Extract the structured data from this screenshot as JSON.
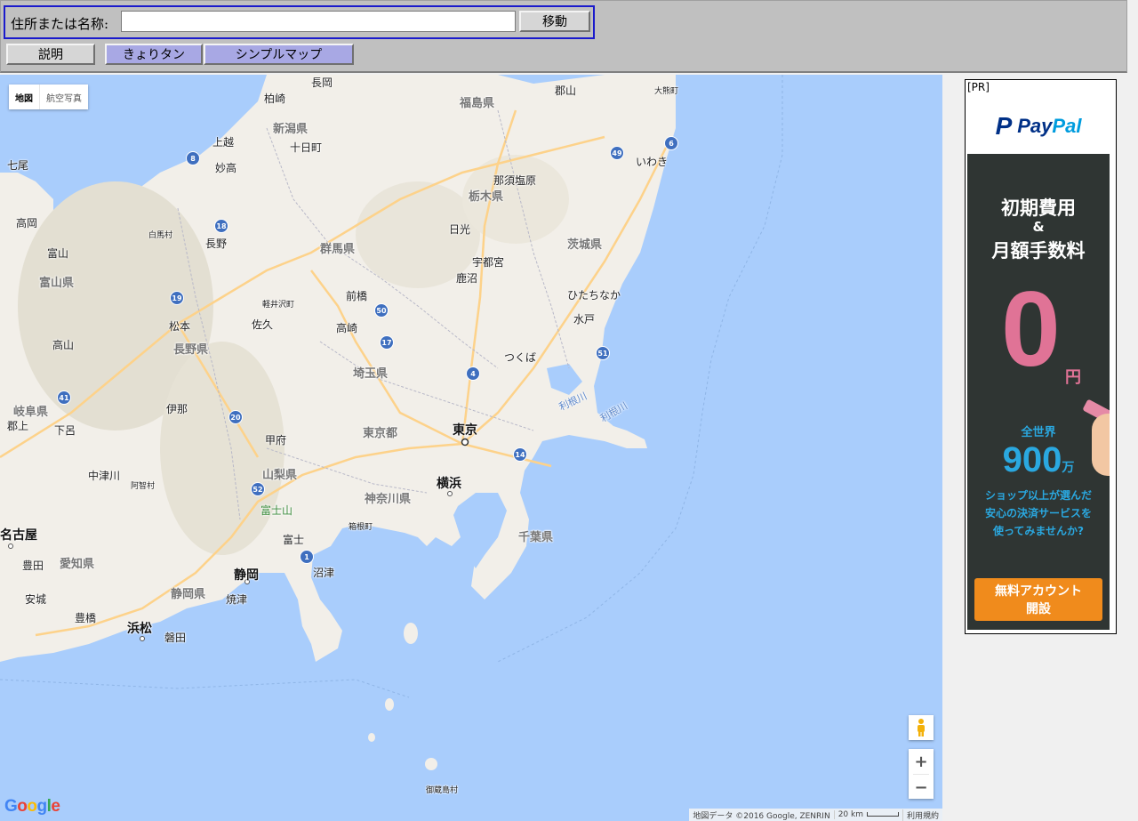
{
  "toolbar": {
    "search_label": "住所または名称:",
    "search_value": "",
    "move_label": "移動",
    "help_label": "説明",
    "kyori_label": "きょりタン",
    "simple_map_label": "シンプルマップ"
  },
  "map": {
    "type_control": {
      "map": "地図",
      "satellite": "航空写真"
    },
    "prefectures": [
      "新潟県",
      "福島県",
      "栃木県",
      "群馬県",
      "茨城県",
      "富山県",
      "長野県",
      "埼玉県",
      "岐阜県",
      "東京都",
      "山梨県",
      "神奈川県",
      "千葉県",
      "愛知県",
      "静岡県"
    ],
    "cities": [
      "長岡",
      "郡山",
      "柏崎",
      "大熊町",
      "十日町",
      "上越",
      "いわき",
      "妙高",
      "七尾",
      "那須塩原",
      "高岡",
      "日光",
      "白馬村",
      "長野",
      "富山",
      "宇都宮",
      "鹿沼",
      "前橋",
      "ひたちなか",
      "軽井沢町",
      "水戸",
      "松本",
      "佐久",
      "高崎",
      "高山",
      "つくば",
      "伊那",
      "郡上",
      "下呂",
      "甲府",
      "中津川",
      "阿智村",
      "富士山",
      "富士",
      "箱根町",
      "豊田",
      "沼津",
      "安城",
      "焼津",
      "豊橋",
      "磐田",
      "御蔵島村"
    ],
    "major_cities": [
      "東京",
      "横浜",
      "名古屋",
      "静岡",
      "浜松"
    ],
    "rivers": [
      "利根川",
      "利根川"
    ],
    "route_numbers": [
      "8",
      "18",
      "19",
      "6",
      "49",
      "50",
      "17",
      "4",
      "51",
      "41",
      "20",
      "14",
      "52",
      "1"
    ],
    "zoom_in": "+",
    "zoom_out": "−",
    "google_logo": "Google",
    "attribution": {
      "data": "地図データ ©2016 Google, ZENRIN",
      "scale": "20 km",
      "terms": "利用規約"
    }
  },
  "ad": {
    "pr_label": "[PR]",
    "brand": "PayPal",
    "line1": "初期費用",
    "line2": "&",
    "line3": "月額手数料",
    "zero": "0",
    "yen": "円",
    "world": "全世界",
    "count": "900",
    "count_unit": "万",
    "sub1": "ショップ以上が選んだ",
    "sub2": "安心の決済サービスを",
    "sub3": "使ってみませんか?",
    "cta1": "無料アカウント",
    "cta2": "開設"
  },
  "colors": {
    "toolbar_bg": "#c0c0c0",
    "search_border": "#1a1acc",
    "purple_button": "#a8a8e4",
    "sea": "#a9cdfc",
    "land": "#f2efe9",
    "paypal_navy": "#003087",
    "paypal_blue": "#009cde",
    "cta_orange": "#f08b1c"
  }
}
